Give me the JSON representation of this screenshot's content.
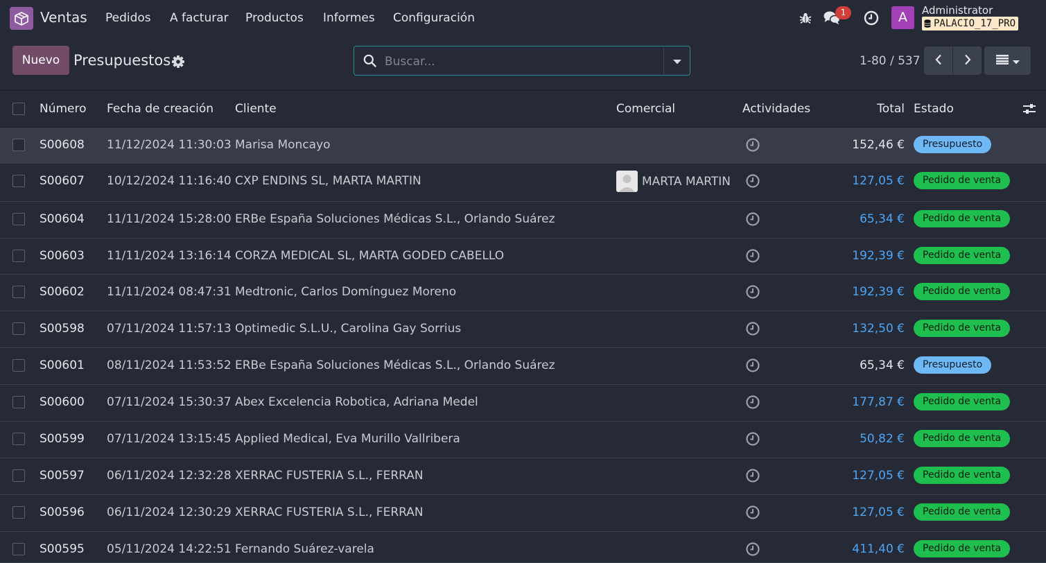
{
  "navbar": {
    "app_name": "Ventas",
    "menu": [
      "Pedidos",
      "A facturar",
      "Productos",
      "Informes",
      "Configuración"
    ],
    "message_count": "1",
    "user_initial": "A",
    "user_name": "Administrator",
    "database": "PALACIO_17_PRO"
  },
  "control_panel": {
    "new_label": "Nuevo",
    "title": "Presupuestos",
    "search_placeholder": "Buscar...",
    "pager": "1-80 / 537"
  },
  "table": {
    "columns": {
      "number": "Número",
      "date": "Fecha de creación",
      "client": "Cliente",
      "salesman": "Comercial",
      "activities": "Actividades",
      "total": "Total",
      "status": "Estado"
    },
    "rows": [
      {
        "number": "S00608",
        "date": "11/12/2024 11:30:03",
        "client": "Marisa Moncayo",
        "salesman": "",
        "total": "152,46 €",
        "total_style": "plain",
        "status": "Presupuesto",
        "status_type": "q"
      },
      {
        "number": "S00607",
        "date": "10/12/2024 11:16:40",
        "client": "CXP ENDINS SL, MARTA MARTIN",
        "salesman": "MARTA MARTIN",
        "total": "127,05 €",
        "total_style": "blue",
        "status": "Pedido de venta",
        "status_type": "s"
      },
      {
        "number": "S00604",
        "date": "11/11/2024 15:28:00",
        "client": "ERBe España Soluciones Médicas S.L., Orlando Suárez",
        "salesman": "",
        "total": "65,34 €",
        "total_style": "blue",
        "status": "Pedido de venta",
        "status_type": "s"
      },
      {
        "number": "S00603",
        "date": "11/11/2024 13:16:14",
        "client": "CORZA MEDICAL SL, MARTA GODED CABELLO",
        "salesman": "",
        "total": "192,39 €",
        "total_style": "blue",
        "status": "Pedido de venta",
        "status_type": "s"
      },
      {
        "number": "S00602",
        "date": "11/11/2024 08:47:31",
        "client": "Medtronic, Carlos Domínguez Moreno",
        "salesman": "",
        "total": "192,39 €",
        "total_style": "blue",
        "status": "Pedido de venta",
        "status_type": "s"
      },
      {
        "number": "S00598",
        "date": "07/11/2024 11:57:13",
        "client": "Optimedic S.L.U., Carolina Gay Sorrius",
        "salesman": "",
        "total": "132,50 €",
        "total_style": "blue",
        "status": "Pedido de venta",
        "status_type": "s"
      },
      {
        "number": "S00601",
        "date": "08/11/2024 11:53:52",
        "client": "ERBe España Soluciones Médicas S.L., Orlando Suárez",
        "salesman": "",
        "total": "65,34 €",
        "total_style": "plain",
        "status": "Presupuesto",
        "status_type": "q"
      },
      {
        "number": "S00600",
        "date": "07/11/2024 15:30:37",
        "client": "Abex Excelencia Robotica, Adriana Medel",
        "salesman": "",
        "total": "177,87 €",
        "total_style": "blue",
        "status": "Pedido de venta",
        "status_type": "s"
      },
      {
        "number": "S00599",
        "date": "07/11/2024 13:15:45",
        "client": "Applied Medical, Eva Murillo Vallribera",
        "salesman": "",
        "total": "50,82 €",
        "total_style": "blue",
        "status": "Pedido de venta",
        "status_type": "s"
      },
      {
        "number": "S00597",
        "date": "06/11/2024 12:32:28",
        "client": "XERRAC FUSTERIA S.L., FERRAN",
        "salesman": "",
        "total": "127,05 €",
        "total_style": "blue",
        "status": "Pedido de venta",
        "status_type": "s"
      },
      {
        "number": "S00596",
        "date": "06/11/2024 12:30:29",
        "client": "XERRAC FUSTERIA S.L., FERRAN",
        "salesman": "",
        "total": "127,05 €",
        "total_style": "blue",
        "status": "Pedido de venta",
        "status_type": "s"
      },
      {
        "number": "S00595",
        "date": "05/11/2024 14:22:51",
        "client": "Fernando Suárez-varela",
        "salesman": "",
        "total": "411,40 €",
        "total_style": "blue",
        "status": "Pedido de venta",
        "status_type": "s"
      }
    ]
  }
}
